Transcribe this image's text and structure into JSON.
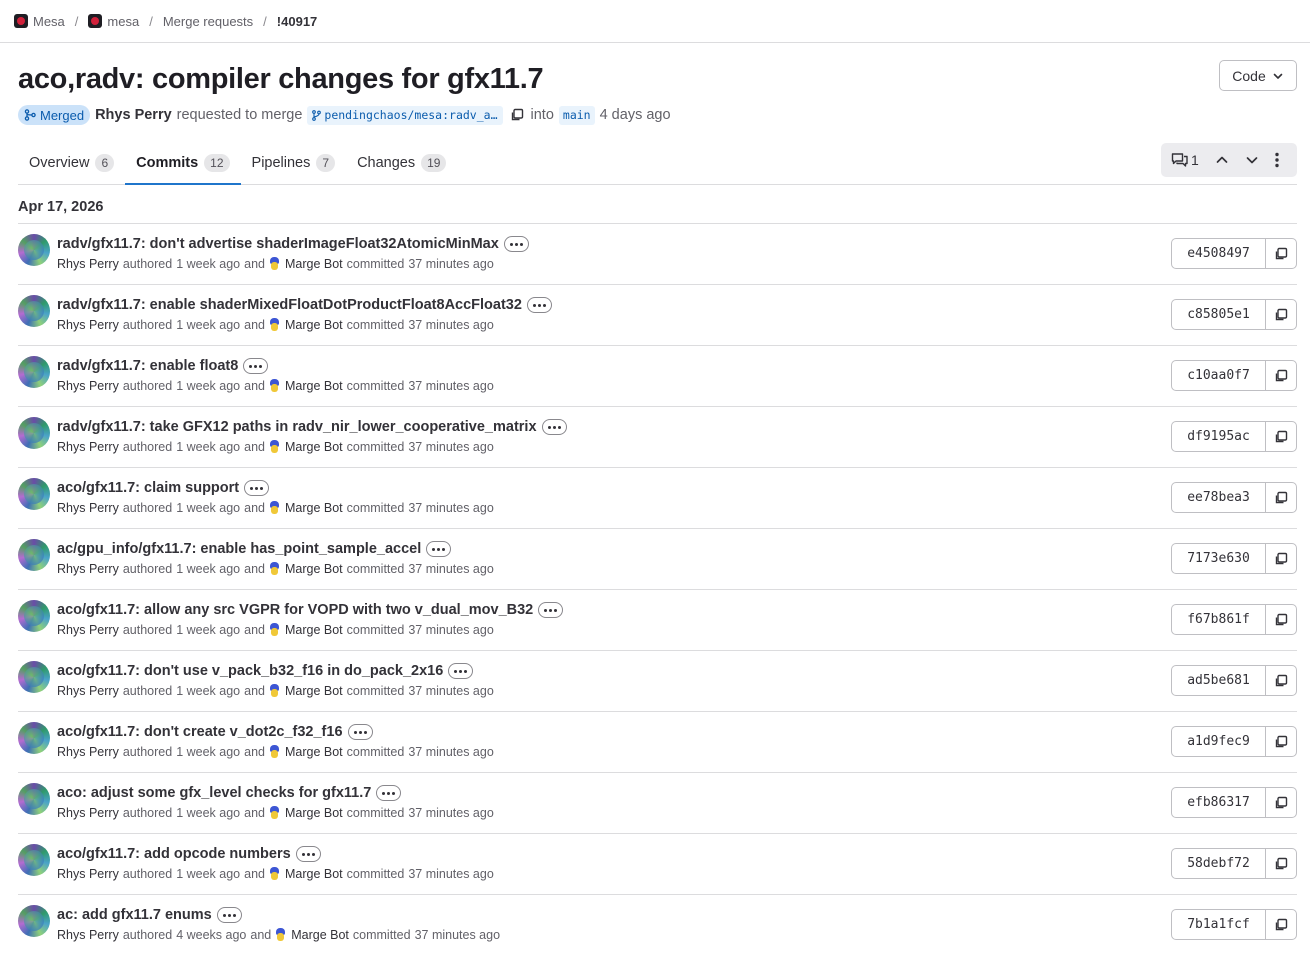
{
  "breadcrumb": {
    "items": [
      "Mesa",
      "mesa",
      "Merge requests",
      "!40917"
    ]
  },
  "header": {
    "title": "aco,radv: compiler changes for gfx11.7",
    "code_button": "Code",
    "status": "Merged",
    "author": "Rhys Perry",
    "requested_text": "requested to merge",
    "source_branch": "pendingchaos/mesa:radv_a…",
    "into_text": "into",
    "target_branch": "main",
    "time": "4 days ago"
  },
  "tabs": [
    {
      "label": "Overview",
      "count": "6"
    },
    {
      "label": "Commits",
      "count": "12"
    },
    {
      "label": "Pipelines",
      "count": "7"
    },
    {
      "label": "Changes",
      "count": "19"
    }
  ],
  "tab_actions": {
    "discussion_count": "1"
  },
  "date_heading": "Apr 17, 2026",
  "commits": [
    {
      "title": "radv/gfx11.7: don't advertise shaderImageFloat32AtomicMinMax",
      "author": "Rhys Perry",
      "authored_label": "authored",
      "authored_time": "1 week ago",
      "and_label": "and",
      "committer": "Marge Bot",
      "committed_label": "committed",
      "committed_time": "37 minutes ago",
      "sha": "e4508497"
    },
    {
      "title": "radv/gfx11.7: enable shaderMixedFloatDotProductFloat8AccFloat32",
      "author": "Rhys Perry",
      "authored_label": "authored",
      "authored_time": "1 week ago",
      "and_label": "and",
      "committer": "Marge Bot",
      "committed_label": "committed",
      "committed_time": "37 minutes ago",
      "sha": "c85805e1"
    },
    {
      "title": "radv/gfx11.7: enable float8",
      "author": "Rhys Perry",
      "authored_label": "authored",
      "authored_time": "1 week ago",
      "and_label": "and",
      "committer": "Marge Bot",
      "committed_label": "committed",
      "committed_time": "37 minutes ago",
      "sha": "c10aa0f7"
    },
    {
      "title": "radv/gfx11.7: take GFX12 paths in radv_nir_lower_cooperative_matrix",
      "author": "Rhys Perry",
      "authored_label": "authored",
      "authored_time": "1 week ago",
      "and_label": "and",
      "committer": "Marge Bot",
      "committed_label": "committed",
      "committed_time": "37 minutes ago",
      "sha": "df9195ac"
    },
    {
      "title": "aco/gfx11.7: claim support",
      "author": "Rhys Perry",
      "authored_label": "authored",
      "authored_time": "1 week ago",
      "and_label": "and",
      "committer": "Marge Bot",
      "committed_label": "committed",
      "committed_time": "37 minutes ago",
      "sha": "ee78bea3"
    },
    {
      "title": "ac/gpu_info/gfx11.7: enable has_point_sample_accel",
      "author": "Rhys Perry",
      "authored_label": "authored",
      "authored_time": "1 week ago",
      "and_label": "and",
      "committer": "Marge Bot",
      "committed_label": "committed",
      "committed_time": "37 minutes ago",
      "sha": "7173e630"
    },
    {
      "title": "aco/gfx11.7: allow any src VGPR for VOPD with two v_dual_mov_B32",
      "author": "Rhys Perry",
      "authored_label": "authored",
      "authored_time": "1 week ago",
      "and_label": "and",
      "committer": "Marge Bot",
      "committed_label": "committed",
      "committed_time": "37 minutes ago",
      "sha": "f67b861f"
    },
    {
      "title": "aco/gfx11.7: don't use v_pack_b32_f16 in do_pack_2x16",
      "author": "Rhys Perry",
      "authored_label": "authored",
      "authored_time": "1 week ago",
      "and_label": "and",
      "committer": "Marge Bot",
      "committed_label": "committed",
      "committed_time": "37 minutes ago",
      "sha": "ad5be681"
    },
    {
      "title": "aco/gfx11.7: don't create v_dot2c_f32_f16",
      "author": "Rhys Perry",
      "authored_label": "authored",
      "authored_time": "1 week ago",
      "and_label": "and",
      "committer": "Marge Bot",
      "committed_label": "committed",
      "committed_time": "37 minutes ago",
      "sha": "a1d9fec9"
    },
    {
      "title": "aco: adjust some gfx_level checks for gfx11.7",
      "author": "Rhys Perry",
      "authored_label": "authored",
      "authored_time": "1 week ago",
      "and_label": "and",
      "committer": "Marge Bot",
      "committed_label": "committed",
      "committed_time": "37 minutes ago",
      "sha": "efb86317"
    },
    {
      "title": "aco/gfx11.7: add opcode numbers",
      "author": "Rhys Perry",
      "authored_label": "authored",
      "authored_time": "1 week ago",
      "and_label": "and",
      "committer": "Marge Bot",
      "committed_label": "committed",
      "committed_time": "37 minutes ago",
      "sha": "58debf72"
    },
    {
      "title": "ac: add gfx11.7 enums",
      "author": "Rhys Perry",
      "authored_label": "authored",
      "authored_time": "4 weeks ago",
      "and_label": "and",
      "committer": "Marge Bot",
      "committed_label": "committed",
      "committed_time": "37 minutes ago",
      "sha": "7b1a1fcf"
    }
  ]
}
